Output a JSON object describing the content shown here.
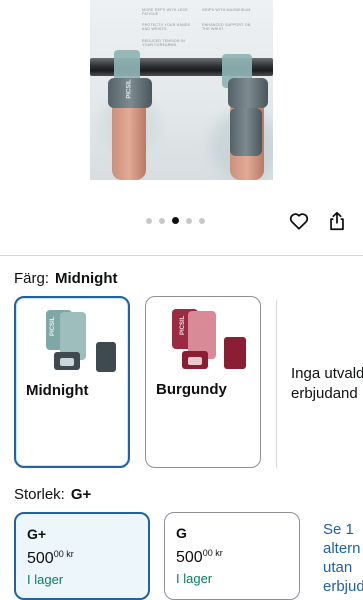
{
  "hero": {
    "features": [
      "MORE REPS WITH LESS FATIGUE",
      "GRIPS WITH MAGNESIUM",
      "PROTECTS YOUR HANDS AND WRISTS",
      "ENHANCED SUPPORT ON THE WRIST",
      "REDUCED TENSION IN YOUR FOREARMS"
    ],
    "logo_text": "PICSIL"
  },
  "gallery": {
    "dot_count": 5,
    "active_index": 2
  },
  "actions": {
    "favorite_icon": "heart-icon",
    "share_icon": "share-icon"
  },
  "color": {
    "label": "Färg:",
    "selected": "Midnight",
    "options": [
      {
        "name": "Midnight",
        "selected": true,
        "colors": [
          "#7fa7a5",
          "#3e4a50"
        ]
      },
      {
        "name": "Burgundy",
        "selected": false,
        "colors": [
          "#b23a4f",
          "#8a1f34"
        ]
      }
    ],
    "unavailable_text_1": "Inga utvald",
    "unavailable_text_2": "erbjudand"
  },
  "size": {
    "label": "Storlek:",
    "selected": "G+",
    "options": [
      {
        "size": "G+",
        "price_whole": "500",
        "price_fraction": "00",
        "currency": "kr",
        "stock": "I lager",
        "selected": true
      },
      {
        "size": "G",
        "price_whole": "500",
        "price_fraction": "00",
        "currency": "kr",
        "stock": "I lager",
        "selected": false
      }
    ],
    "alternatives_link": [
      "Se 1",
      "altern",
      "utan",
      "erbjud"
    ]
  },
  "colors": {
    "accent": "#2162a1",
    "stock_green": "#067d62",
    "selected_bg": "#edf7fb"
  }
}
